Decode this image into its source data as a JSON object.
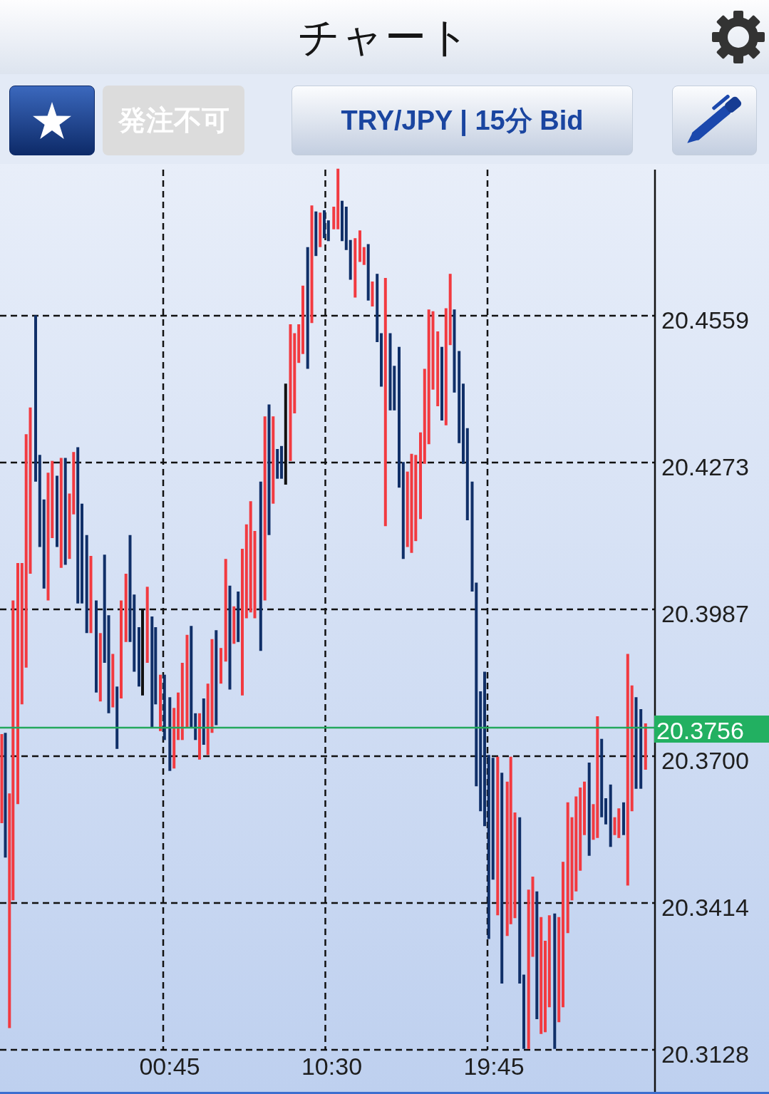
{
  "header": {
    "title": "チャート"
  },
  "toolbar": {
    "order_button": {
      "label": "発注不可",
      "disabled": true
    },
    "symbol_button": {
      "label": "TRY/JPY | 15分 Bid"
    }
  },
  "chart": {
    "price_axis_labels": [
      "20.4559",
      "20.4273",
      "20.3987",
      "20.3700",
      "20.3414",
      "20.3128"
    ],
    "time_axis_labels": [
      "00:45",
      "10:30",
      "19:45"
    ],
    "current_price": "20.3756"
  }
}
